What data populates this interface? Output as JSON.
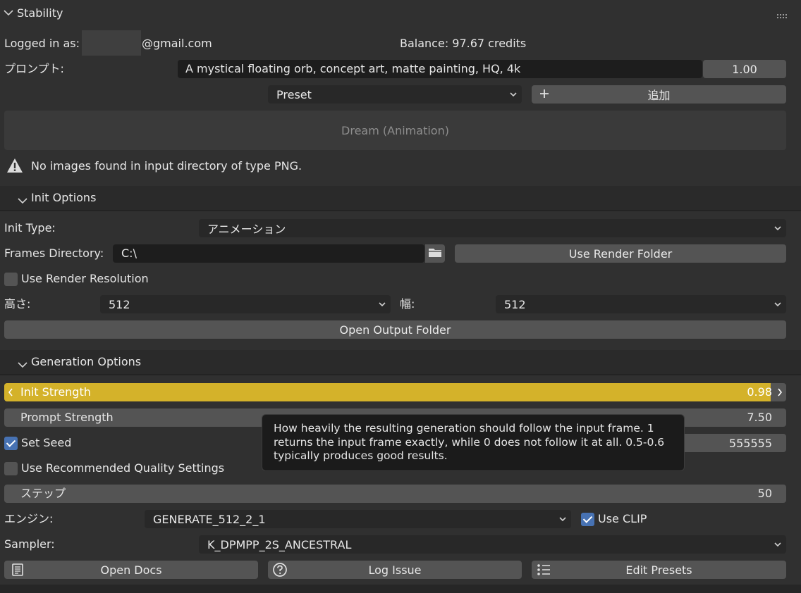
{
  "header": {
    "title": "Stability",
    "grip_icon": "drag-grip-icon"
  },
  "account": {
    "logged_in_label": "Logged in as:",
    "email_suffix": "@gmail.com",
    "balance": "Balance: 97.67 credits"
  },
  "prompt": {
    "label": "プロンプト:",
    "value": "A mystical floating orb, concept art, matte painting, HQ, 4k",
    "weight": "1.00"
  },
  "preset": {
    "selected": "Preset",
    "add_label": "追加"
  },
  "dream_button": "Dream (Animation)",
  "warning": "No images found in input directory of type PNG.",
  "init_options": {
    "title": "Init Options",
    "init_type_label": "Init Type:",
    "init_type_value": "アニメーション",
    "frames_dir_label": "Frames Directory:",
    "frames_dir_value": "C:\\",
    "use_render_folder": "Use Render Folder",
    "use_render_resolution": "Use Render Resolution",
    "use_render_resolution_checked": false,
    "height_label": "高さ:",
    "height_value": "512",
    "width_label": "幅:",
    "width_value": "512",
    "open_output_folder": "Open Output Folder"
  },
  "generation_options": {
    "title": "Generation Options",
    "init_strength_label": "Init Strength",
    "init_strength_value": "0.98",
    "init_strength_fraction": 0.98,
    "prompt_strength_label": "Prompt Strength",
    "prompt_strength_value": "7.50",
    "set_seed_label": "Set Seed",
    "set_seed_checked": true,
    "seed_value": "555555",
    "quality_label": "Use Recommended Quality Settings",
    "quality_checked": false,
    "steps_label": "ステップ",
    "steps_value": "50",
    "engine_label": "エンジン:",
    "engine_value": "GENERATE_512_2_1",
    "use_clip_label": "Use CLIP",
    "use_clip_checked": true,
    "sampler_label": "Sampler:",
    "sampler_value": "K_DPMPP_2S_ANCESTRAL"
  },
  "tooltip": "How heavily the resulting generation should follow the input frame. 1 returns the input frame exactly, while 0 does not follow it at all. 0.5-0.6 typically produces good results.",
  "footer": {
    "open_docs": "Open Docs",
    "log_issue": "Log Issue",
    "edit_presets": "Edit Presets"
  },
  "colors": {
    "accent_slider": "#d4b22a",
    "checkbox_on": "#4772b3",
    "panel_bg": "#303030"
  }
}
